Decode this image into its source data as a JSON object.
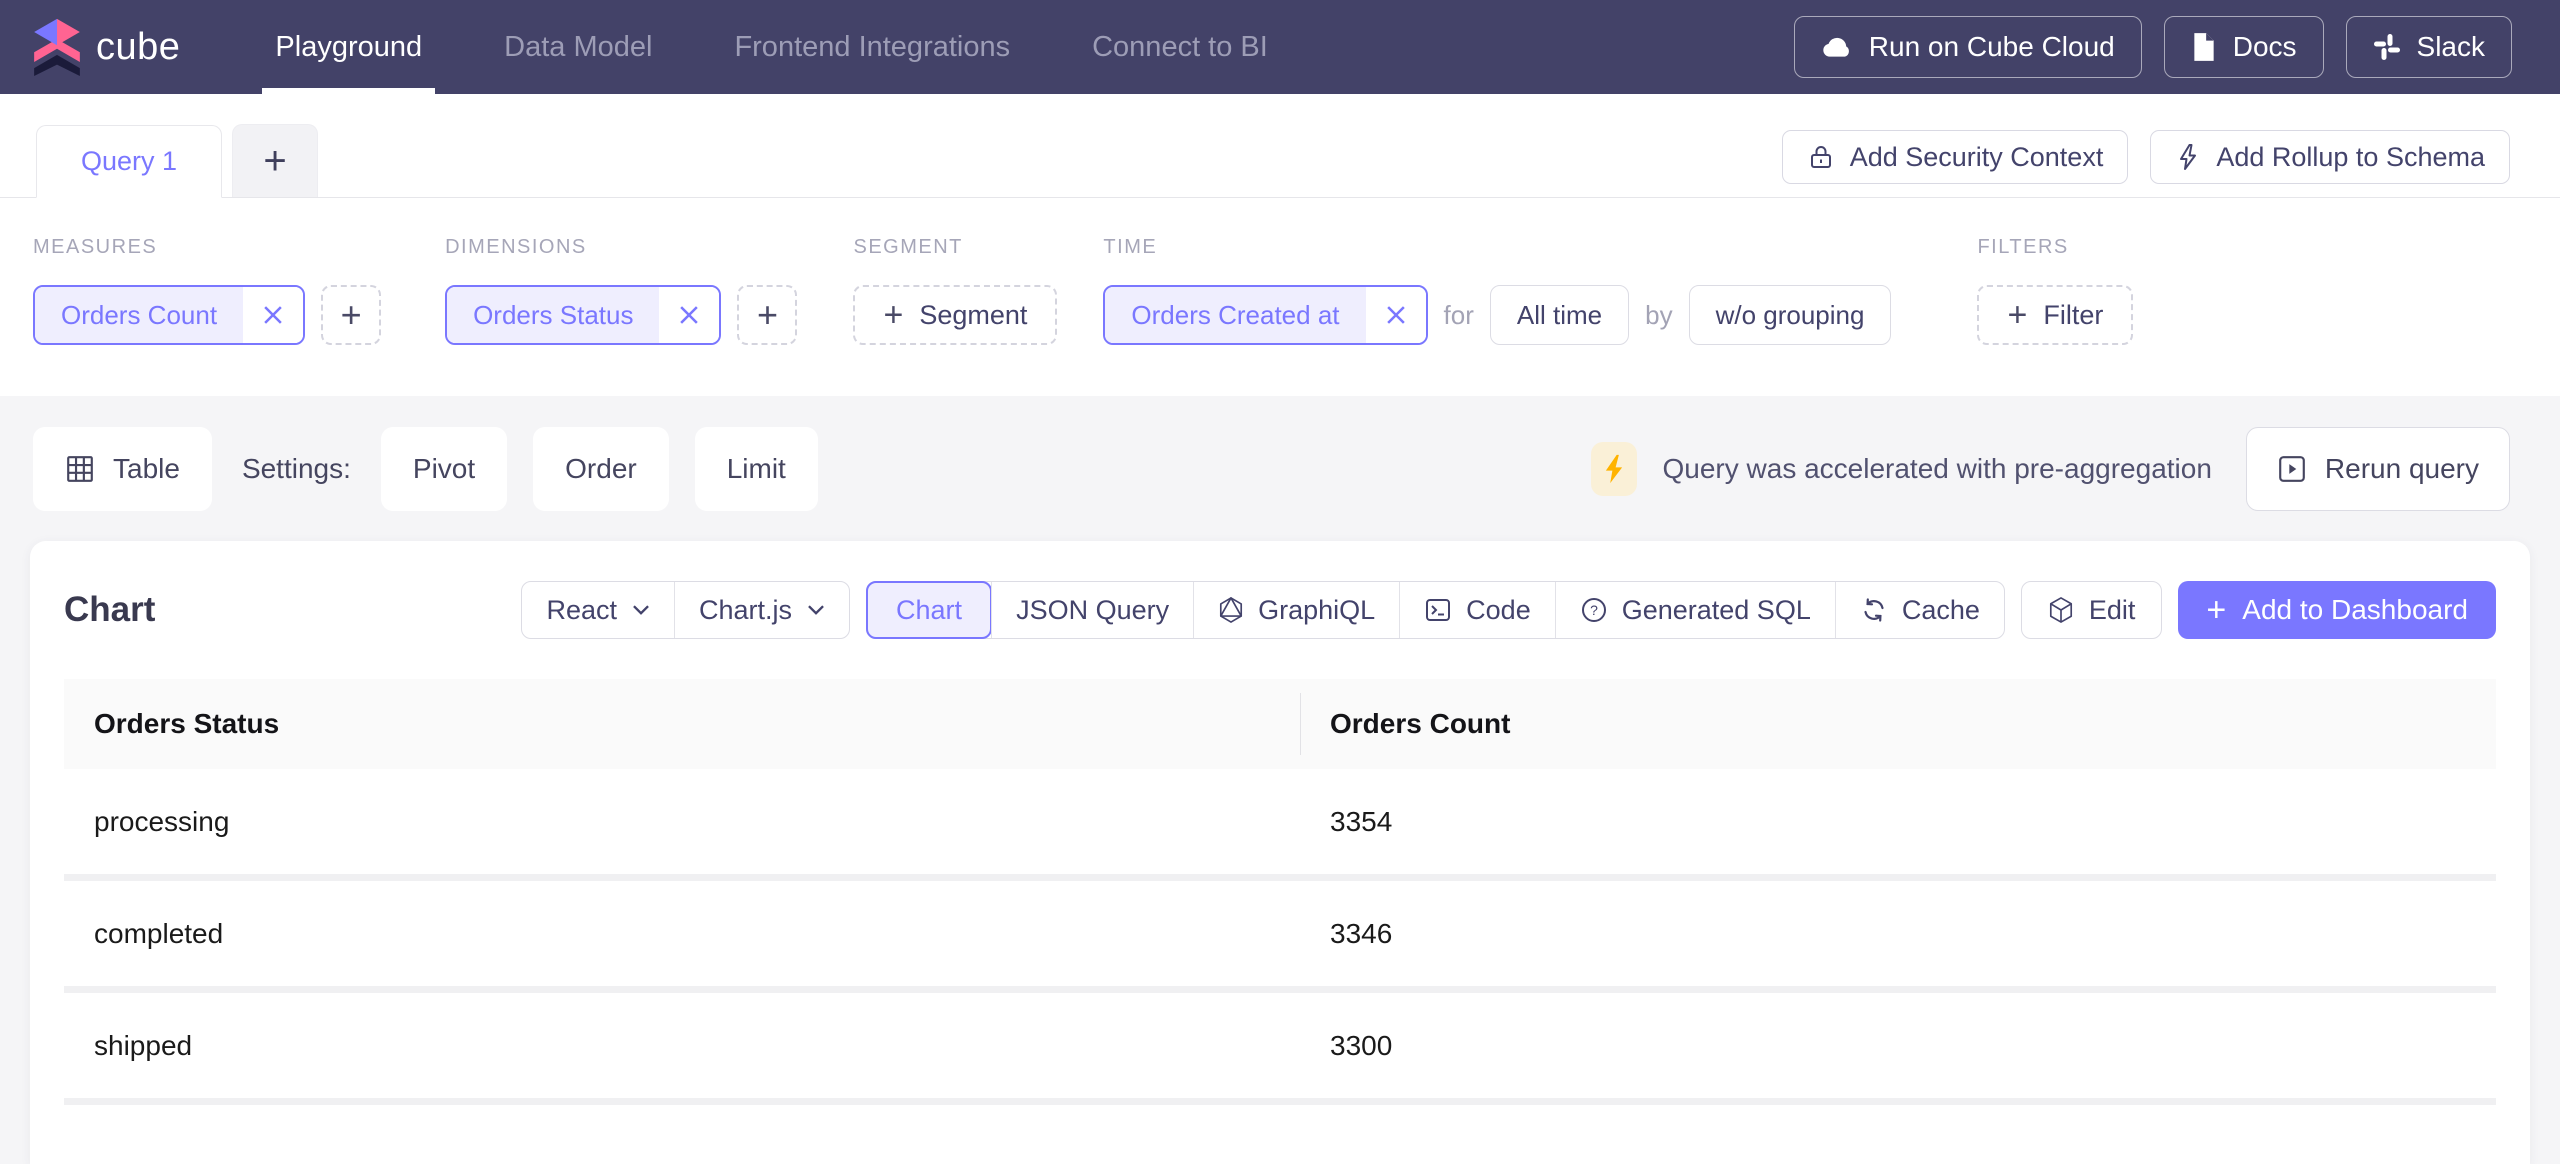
{
  "nav": {
    "brand": "cube",
    "items": [
      {
        "label": "Playground"
      },
      {
        "label": "Data Model"
      },
      {
        "label": "Frontend Integrations"
      },
      {
        "label": "Connect to BI"
      }
    ],
    "actions": [
      {
        "label": "Run on Cube Cloud",
        "icon": "cloud-icon"
      },
      {
        "label": "Docs",
        "icon": "document-icon"
      },
      {
        "label": "Slack",
        "icon": "slack-icon"
      }
    ]
  },
  "tabbar": {
    "tabs": [
      {
        "label": "Query 1"
      }
    ],
    "add_tab_label": "+",
    "actions": [
      {
        "label": "Add Security Context",
        "icon": "lock-icon"
      },
      {
        "label": "Add Rollup to Schema",
        "icon": "thunderbolt-icon"
      }
    ]
  },
  "builder": {
    "measures": {
      "label": "MEASURES",
      "chips": [
        {
          "name": "Orders Count"
        }
      ]
    },
    "dimensions": {
      "label": "DIMENSIONS",
      "chips": [
        {
          "name": "Orders Status"
        }
      ]
    },
    "segment": {
      "label": "SEGMENT",
      "add_label": "Segment"
    },
    "time": {
      "label": "TIME",
      "chips": [
        {
          "name": "Orders Created at"
        }
      ],
      "for_label": "for",
      "date_range": "All time",
      "by_label": "by",
      "granularity": "w/o grouping"
    },
    "filters": {
      "label": "FILTERS",
      "add_label": "Filter"
    }
  },
  "settings_bar": {
    "table_label": "Table",
    "settings_label": "Settings:",
    "pivot_label": "Pivot",
    "order_label": "Order",
    "limit_label": "Limit",
    "acceleration_message": "Query was accelerated with pre-aggregation",
    "rerun_label": "Rerun query"
  },
  "chart_panel": {
    "title": "Chart",
    "framework": "React",
    "library": "Chart.js",
    "views": {
      "chart": "Chart",
      "json_query": "JSON Query",
      "graphiql": "GraphiQL",
      "code": "Code",
      "generated_sql": "Generated SQL",
      "cache": "Cache"
    },
    "edit_label": "Edit",
    "add_to_dashboard_label": "Add to Dashboard"
  },
  "chart_data": {
    "type": "table",
    "title": "Chart",
    "columns": [
      "Orders Status",
      "Orders Count"
    ],
    "rows": [
      [
        "processing",
        "3354"
      ],
      [
        "completed",
        "3346"
      ],
      [
        "shipped",
        "3300"
      ]
    ]
  },
  "colors": {
    "accent": "#7A77FF",
    "navbar_bg": "#434268",
    "pink": "#FF6492",
    "bolt_yellow": "#FFB300",
    "badge_bg": "#FAF0D7"
  }
}
